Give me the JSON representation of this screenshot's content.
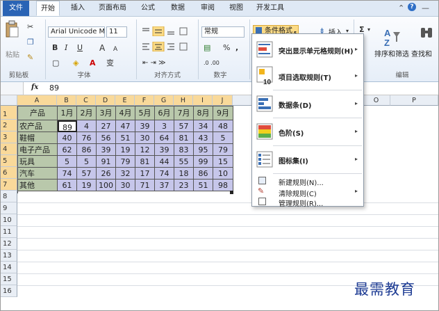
{
  "ribbon_tabs": [
    "文件",
    "开始",
    "插入",
    "页面布局",
    "公式",
    "数据",
    "审阅",
    "视图",
    "开发工具"
  ],
  "window_controls": {
    "up_icon": "chevron-up-icon",
    "help": "?",
    "minimize": "—"
  },
  "clipboard": {
    "paste": "粘贴",
    "cut_icon": "scissors-icon",
    "copy_icon": "copy-icon",
    "format_painter_icon": "brush-icon",
    "group_label": "剪贴板"
  },
  "font": {
    "name": "Arial Unicode M",
    "size": "11",
    "bold": "B",
    "italic": "I",
    "underline": "U",
    "grow": "A",
    "shrink": "A",
    "phonetic": "变",
    "group_label": "字体"
  },
  "alignment": {
    "group_label": "对齐方式"
  },
  "number": {
    "format": "常规",
    "percent": "%",
    "comma": ",",
    "group_label": "数字"
  },
  "styles": {
    "conditional_formatting": "条件格式"
  },
  "cells": {
    "insert": "插入"
  },
  "editing": {
    "sigma": "Σ",
    "sort_filter": "排序和筛选",
    "find_select": "查找和",
    "group_label": "编辑"
  },
  "formula_bar": {
    "fx": "fx",
    "value": "89"
  },
  "columns": [
    "A",
    "B",
    "C",
    "D",
    "E",
    "F",
    "G",
    "H",
    "I",
    "J",
    "",
    "O",
    "P"
  ],
  "rows": [
    "1",
    "2",
    "3",
    "4",
    "5",
    "6",
    "7",
    "8",
    "9",
    "10",
    "11",
    "12",
    "13",
    "14",
    "15",
    "16"
  ],
  "table": {
    "header": [
      "产品",
      "1月",
      "2月",
      "3月",
      "4月",
      "5月",
      "6月",
      "7月",
      "8月",
      "9月"
    ],
    "data": [
      [
        "农产品",
        "89",
        "4",
        "27",
        "47",
        "39",
        "3",
        "57",
        "34",
        "48"
      ],
      [
        "鞋帽",
        "40",
        "76",
        "56",
        "51",
        "30",
        "64",
        "81",
        "43",
        "5"
      ],
      [
        "电子产品",
        "62",
        "86",
        "39",
        "19",
        "12",
        "39",
        "83",
        "95",
        "79"
      ],
      [
        "玩具",
        "5",
        "5",
        "91",
        "79",
        "81",
        "44",
        "55",
        "99",
        "15"
      ],
      [
        "汽车",
        "74",
        "57",
        "26",
        "32",
        "17",
        "74",
        "18",
        "86",
        "10"
      ],
      [
        "其他",
        "61",
        "19",
        "100",
        "30",
        "71",
        "37",
        "23",
        "51",
        "98"
      ]
    ]
  },
  "menu": {
    "items": [
      {
        "label": "突出显示单元格规则(H)",
        "icon": "highlight-cells-rules-icon",
        "submenu": true
      },
      {
        "label": "项目选取规则(T)",
        "icon": "top-bottom-rules-icon",
        "submenu": true
      },
      {
        "label": "数据条(D)",
        "icon": "data-bars-icon",
        "submenu": true
      },
      {
        "label": "色阶(S)",
        "icon": "color-scales-icon",
        "submenu": true
      },
      {
        "label": "图标集(I)",
        "icon": "icon-sets-icon",
        "submenu": true
      }
    ],
    "small_items": [
      {
        "label": "新建规则(N)...",
        "icon": "new-rule-icon"
      },
      {
        "label": "清除规则(C)",
        "icon": "clear-rules-icon",
        "submenu": true
      },
      {
        "label": "管理规则(R)...",
        "icon": "manage-rules-icon"
      }
    ],
    "arrow": "▸"
  },
  "watermark": "最需教育",
  "colors": {
    "header_fill": "#b9c8ab",
    "value_fill": "#c6c6ea",
    "selected_header": "#f9d99a",
    "file_tab": "#2a64b5",
    "cf_button": "#fbdb86"
  }
}
